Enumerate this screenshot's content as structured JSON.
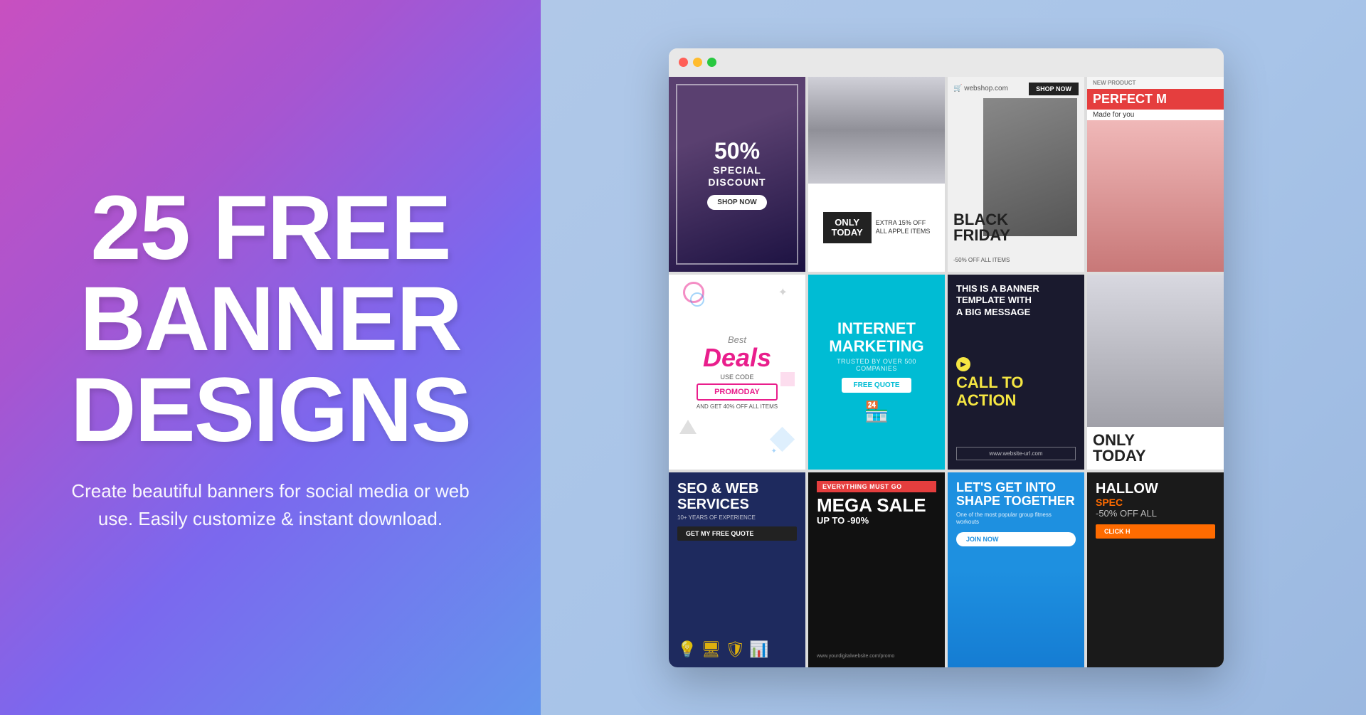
{
  "left": {
    "heading_line1": "25 FREE",
    "heading_line2": "BANNER",
    "heading_line3": "DESIGNS",
    "sub_text": "Create beautiful banners for social media or web use. Easily customize & instant download."
  },
  "browser": {
    "banners": [
      {
        "id": "b1",
        "title": "50% SPECIAL DISCOUNT",
        "btn": "SHOP NOW"
      },
      {
        "id": "b2",
        "only_today": "ONLY TODAY",
        "extra": "EXTRA 15% OFF\nALL APPLE ITEMS"
      },
      {
        "id": "b3",
        "title": "BLACK FRIDAY",
        "sub": "-50% OFF ALL ITEMS",
        "shop_text": "webshop.com",
        "btn": "SHOP NOW"
      },
      {
        "id": "b4",
        "new_prod": "NEW PRODUCT",
        "perfect": "PERFECT M",
        "made": "Made for you"
      },
      {
        "id": "b5",
        "best": "Best",
        "deals": "Deals",
        "use_code": "USE CODE",
        "promo": "PROMODAY",
        "and_get": "AND GET 40% OFF ALL ITEMS"
      },
      {
        "id": "b6",
        "title": "INTERNET MARKETING",
        "sub": "TRUSTED BY OVER 500 COMPANIES",
        "btn": "FREE QUOTE"
      },
      {
        "id": "b7",
        "top": "THIS IS A BANNER TEMPLATE WITH A BIG MESSAGE",
        "cta": "CALL TO ACTION",
        "url": "www.website-url.com"
      },
      {
        "id": "b8",
        "only_today": "ONLY TODAY"
      },
      {
        "id": "b9",
        "title": "SEO & WEB SERVICES",
        "sub": "10+ YEARS OF EXPERIENCE",
        "btn": "GET MY FREE QUOTE"
      },
      {
        "id": "b10",
        "everything": "EVERYTHING MUST GO",
        "mega": "MEGA SALE",
        "up": "UP TO -90%",
        "url": "www.yourdigitalwebsite.com/promo"
      },
      {
        "id": "b11",
        "title": "LET'S GET INTO SHAPE TOGETHER",
        "sub": "One of the most popular group fitness workouts",
        "btn": "JOIN NOW"
      },
      {
        "id": "b12",
        "title": "HALLOW",
        "special": "SPEC",
        "off": "-50% OFF ALL",
        "btn": "CLICK H"
      }
    ]
  },
  "colors": {
    "gradient_start": "#c850c0",
    "gradient_mid": "#9b59b6",
    "gradient_end": "#6495ed",
    "bg_right": "#a8c4e8"
  }
}
